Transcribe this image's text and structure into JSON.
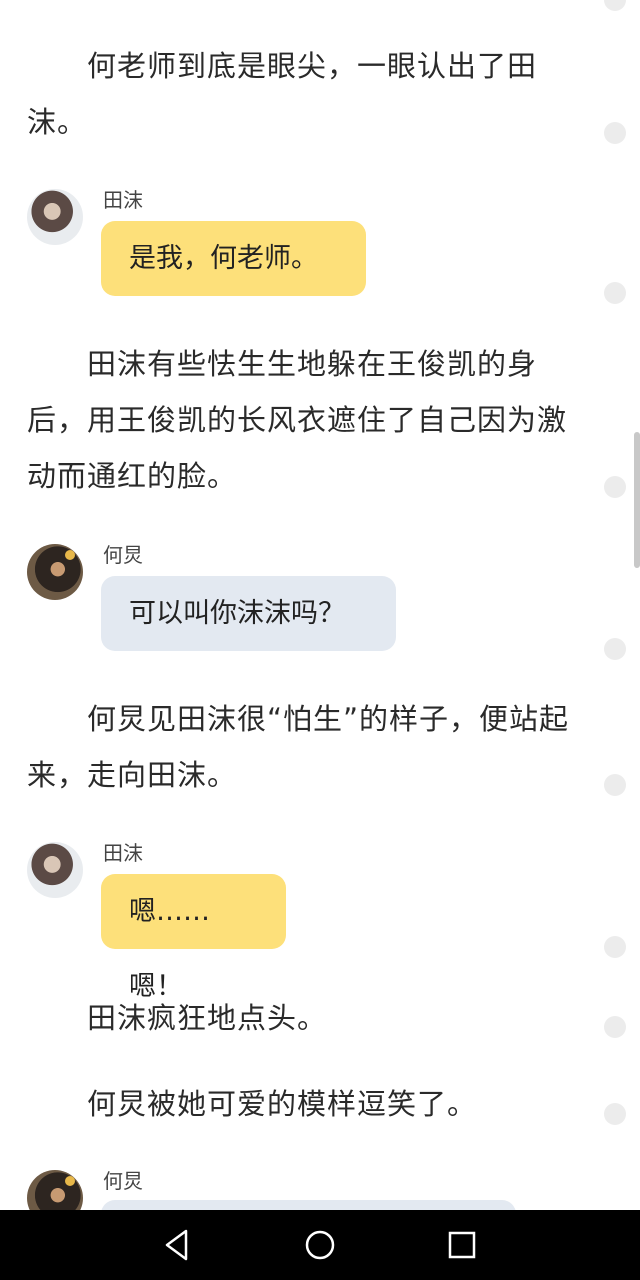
{
  "paragraphs": [
    {
      "text": "何老师到底是眼尖，一眼认出了田沫。"
    },
    {
      "text": "田沫有些怯生生地躲在王俊凯的身后，用王俊凯的长风衣遮住了自己因为激动而通红的脸。"
    },
    {
      "text": "何炅见田沫很“怕生”的样子，便站起来，走向田沫。"
    },
    {
      "text": "田沫疯狂地点头。"
    },
    {
      "text": "何炅被她可爱的模样逗笑了。"
    }
  ],
  "messages": [
    {
      "speaker": "田沫",
      "text": "是我，何老师。",
      "style": "yellow"
    },
    {
      "speaker": "何炅",
      "text": "可以叫你沫沫吗？",
      "style": "grey"
    },
    {
      "speaker": "田沫",
      "text": "嗯……嗯！",
      "style": "yellow"
    },
    {
      "speaker": "何炅",
      "text": "",
      "style": "grey"
    }
  ],
  "icons": {
    "nav_back": "back-triangle-icon",
    "nav_home": "home-circle-icon",
    "nav_recent": "recent-square-icon"
  },
  "colors": {
    "yellow_bubble": "#fde07a",
    "grey_bubble": "#e3e9f1",
    "navbar": "#000000"
  }
}
